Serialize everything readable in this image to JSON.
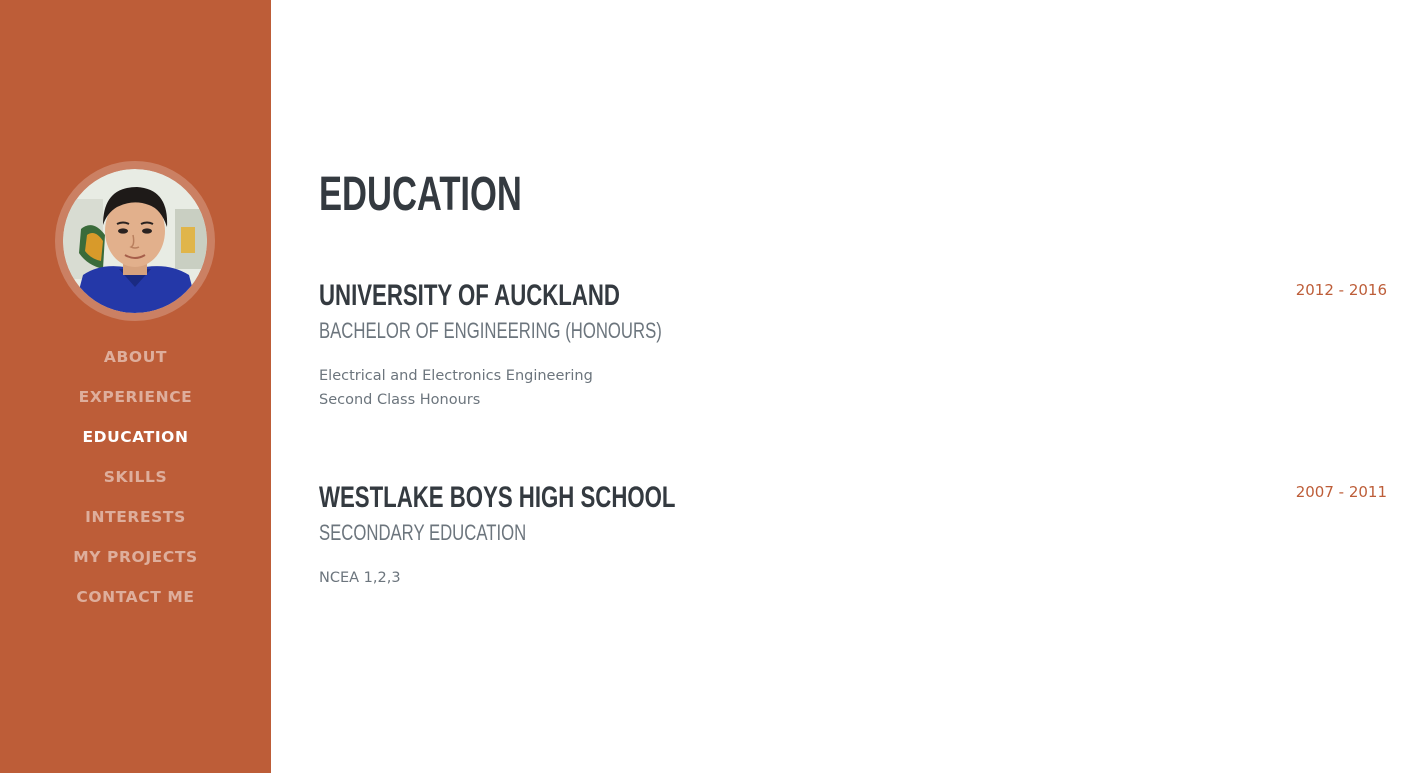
{
  "sidebar": {
    "background": "#bd5d38",
    "avatar_alt": "profile photo",
    "nav": [
      {
        "label": "About"
      },
      {
        "label": "Experience"
      },
      {
        "label": "Education"
      },
      {
        "label": "Skills"
      },
      {
        "label": "Interests"
      },
      {
        "label": "My Projects"
      },
      {
        "label": "Contact Me"
      }
    ],
    "active_item": "Education"
  },
  "main": {
    "section_title": "Education",
    "entries": [
      {
        "title": "University of Auckland",
        "subtitle": "Bachelor of Engineering (Honours)",
        "lines": [
          "Electrical and Electronics Engineering",
          "Second Class Honours"
        ],
        "date": "2012 - 2016"
      },
      {
        "title": "Westlake Boys High School",
        "subtitle": "Secondary Education",
        "lines": [
          "NCEA 1,2,3"
        ],
        "date": "2007 - 2011"
      }
    ]
  },
  "colors": {
    "accent": "#bd5d38",
    "heading": "#343a40",
    "muted": "#6c757d"
  }
}
